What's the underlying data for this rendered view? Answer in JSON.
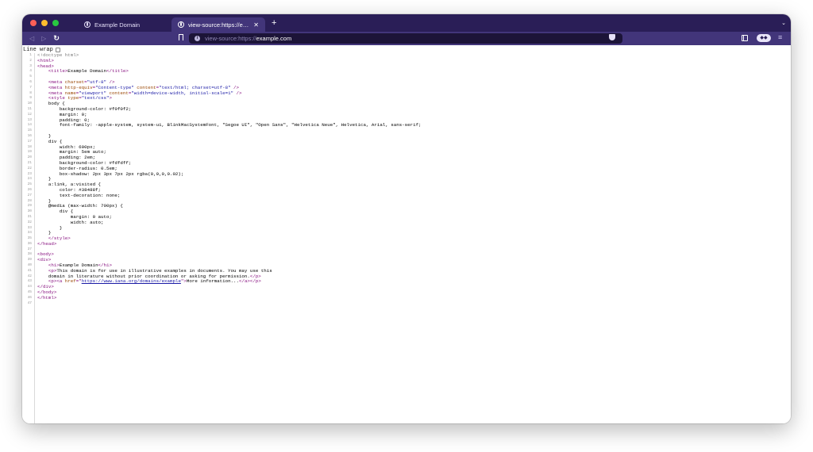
{
  "tabs": [
    {
      "title": "Example Domain",
      "active": false
    },
    {
      "title": "view-source:https://example.com",
      "active": true
    }
  ],
  "toolbar": {
    "url_prefix": "view-source:https://",
    "url_host": "example.com"
  },
  "icons": {
    "back": "back-arrow-icon",
    "forward": "forward-arrow-icon",
    "reload": "reload-icon",
    "bookmark": "bookmark-icon",
    "site_info": "info-icon",
    "shield": "brave-shield-icon",
    "sidebar": "sidebar-icon",
    "vpn": "vpn-icon",
    "menu": "menu-icon"
  },
  "colors": {
    "titlebar": "#2a1e57",
    "toolbar": "#42357a",
    "tag": "#881280",
    "attribute": "#994500",
    "value": "#1a1aa6"
  },
  "source": {
    "line_wrap_label": "Line wrap",
    "line_numbers": [
      "1",
      "2",
      "3",
      "4",
      "5",
      "6",
      "7",
      "8",
      "9",
      "10",
      "11",
      "12",
      "13",
      "14",
      "15",
      "16",
      "17",
      "18",
      "19",
      "20",
      "21",
      "22",
      "23",
      "24",
      "25",
      "26",
      "27",
      "28",
      "29",
      "30",
      "31",
      "32",
      "33",
      "34",
      "35",
      "36",
      "37",
      "38",
      "39",
      "40",
      "41",
      "42",
      "43",
      "44",
      "45",
      "46",
      "47"
    ],
    "lines": [
      [
        [
          "doc",
          "<!doctype html>"
        ]
      ],
      [
        [
          "tag",
          "<html>"
        ]
      ],
      [
        [
          "tag",
          "<head>"
        ]
      ],
      [
        [
          "txt",
          "    "
        ],
        [
          "tag",
          "<title>"
        ],
        [
          "txt",
          "Example Domain"
        ],
        [
          "tag",
          "</title>"
        ]
      ],
      [],
      [
        [
          "txt",
          "    "
        ],
        [
          "tag",
          "<meta "
        ],
        [
          "attr",
          "charset"
        ],
        [
          "tag",
          "="
        ],
        [
          "val",
          "\"utf-8\""
        ],
        [
          "tag",
          " />"
        ]
      ],
      [
        [
          "txt",
          "    "
        ],
        [
          "tag",
          "<meta "
        ],
        [
          "attr",
          "http-equiv"
        ],
        [
          "tag",
          "="
        ],
        [
          "val",
          "\"Content-type\""
        ],
        [
          "attr",
          " content"
        ],
        [
          "tag",
          "="
        ],
        [
          "val",
          "\"text/html; charset=utf-8\""
        ],
        [
          "tag",
          " />"
        ]
      ],
      [
        [
          "txt",
          "    "
        ],
        [
          "tag",
          "<meta "
        ],
        [
          "attr",
          "name"
        ],
        [
          "tag",
          "="
        ],
        [
          "val",
          "\"viewport\""
        ],
        [
          "attr",
          " content"
        ],
        [
          "tag",
          "="
        ],
        [
          "val",
          "\"width=device-width, initial-scale=1\""
        ],
        [
          "tag",
          " />"
        ]
      ],
      [
        [
          "txt",
          "    "
        ],
        [
          "tag",
          "<style "
        ],
        [
          "attr",
          "type"
        ],
        [
          "tag",
          "="
        ],
        [
          "val",
          "\"text/css\""
        ],
        [
          "tag",
          ">"
        ]
      ],
      [
        [
          "txt",
          "    body {"
        ]
      ],
      [
        [
          "txt",
          "        background-color: #f0f0f2;"
        ]
      ],
      [
        [
          "txt",
          "        margin: 0;"
        ]
      ],
      [
        [
          "txt",
          "        padding: 0;"
        ]
      ],
      [
        [
          "txt",
          "        font-family: -apple-system, system-ui, BlinkMacSystemFont, \"Segoe UI\", \"Open Sans\", \"Helvetica Neue\", Helvetica, Arial, sans-serif;"
        ]
      ],
      [],
      [
        [
          "txt",
          "    }"
        ]
      ],
      [
        [
          "txt",
          "    div {"
        ]
      ],
      [
        [
          "txt",
          "        width: 600px;"
        ]
      ],
      [
        [
          "txt",
          "        margin: 5em auto;"
        ]
      ],
      [
        [
          "txt",
          "        padding: 2em;"
        ]
      ],
      [
        [
          "txt",
          "        background-color: #fdfdff;"
        ]
      ],
      [
        [
          "txt",
          "        border-radius: 0.5em;"
        ]
      ],
      [
        [
          "txt",
          "        box-shadow: 2px 3px 7px 2px rgba(0,0,0,0.02);"
        ]
      ],
      [
        [
          "txt",
          "    }"
        ]
      ],
      [
        [
          "txt",
          "    a:link, a:visited {"
        ]
      ],
      [
        [
          "txt",
          "        color: #38488f;"
        ]
      ],
      [
        [
          "txt",
          "        text-decoration: none;"
        ]
      ],
      [
        [
          "txt",
          "    }"
        ]
      ],
      [
        [
          "txt",
          "    @media (max-width: 700px) {"
        ]
      ],
      [
        [
          "txt",
          "        div {"
        ]
      ],
      [
        [
          "txt",
          "            margin: 0 auto;"
        ]
      ],
      [
        [
          "txt",
          "            width: auto;"
        ]
      ],
      [
        [
          "txt",
          "        }"
        ]
      ],
      [
        [
          "txt",
          "    }"
        ]
      ],
      [
        [
          "txt",
          "    "
        ],
        [
          "tag",
          "</style>"
        ]
      ],
      [
        [
          "tag",
          "</head>"
        ]
      ],
      [],
      [
        [
          "tag",
          "<body>"
        ]
      ],
      [
        [
          "tag",
          "<div>"
        ]
      ],
      [
        [
          "txt",
          "    "
        ],
        [
          "tag",
          "<h1>"
        ],
        [
          "txt",
          "Example Domain"
        ],
        [
          "tag",
          "</h1>"
        ]
      ],
      [
        [
          "txt",
          "    "
        ],
        [
          "tag",
          "<p>"
        ],
        [
          "txt",
          "This domain is for use in illustrative examples in documents. You may use this"
        ]
      ],
      [
        [
          "txt",
          "    domain in literature without prior coordination or asking for permission."
        ],
        [
          "tag",
          "</p>"
        ]
      ],
      [
        [
          "txt",
          "    "
        ],
        [
          "tag",
          "<p><a "
        ],
        [
          "attr",
          "href"
        ],
        [
          "tag",
          "=\""
        ],
        [
          "link",
          "https://www.iana.org/domains/example"
        ],
        [
          "tag",
          "\">"
        ],
        [
          "txt",
          "More information..."
        ],
        [
          "tag",
          "</a></p>"
        ]
      ],
      [
        [
          "tag",
          "</div>"
        ]
      ],
      [
        [
          "tag",
          "</body>"
        ]
      ],
      [
        [
          "tag",
          "</html>"
        ]
      ],
      []
    ]
  }
}
